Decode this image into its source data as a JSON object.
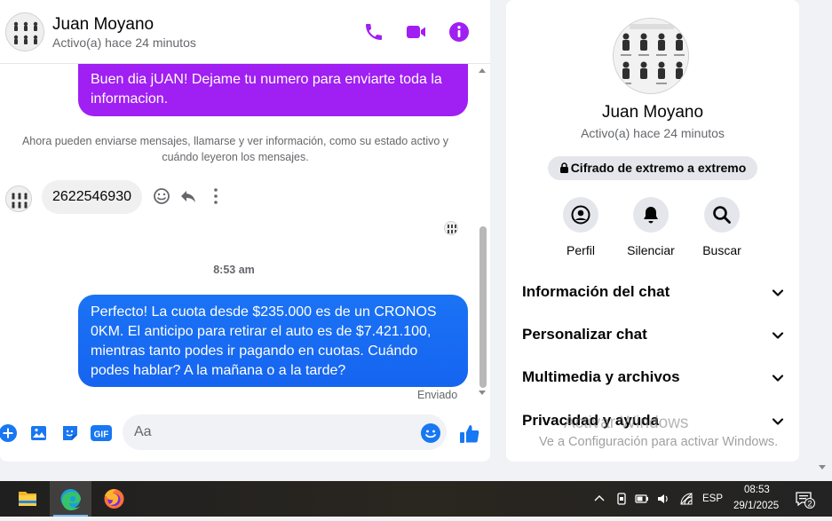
{
  "chat": {
    "contact_name": "Juan Moyano",
    "contact_status": "Activo(a) hace 24 minutos",
    "header_icons": [
      "phone-icon",
      "video-icon",
      "info-icon"
    ],
    "messages": {
      "sent_1": "Buen dia jUAN! Dejame tu numero para enviarte toda la informacion.",
      "system_notice": "Ahora pueden enviarse mensajes, llamarse y ver información, como su estado activo y cuándo leyeron los mensajes.",
      "received_1": "2622546930",
      "timestamp": "8:53 am",
      "sent_2": "Perfecto! La cuota desde $235.000 es de un CRONOS 0KM. El anticipo para retirar el auto es de $7.421.100, mientras tanto podes ir pagando en cuotas. Cuándo podes hablar? A la mañana o a la tarde?",
      "sent_status": "Enviado"
    },
    "composer": {
      "placeholder": "Aa",
      "gif_label": "GIF"
    },
    "colors": {
      "purple_bubble": "#a01ff2",
      "blue_bubble": "#1a73f5",
      "accent": "#a01ff2"
    }
  },
  "info_panel": {
    "name": "Juan Moyano",
    "status": "Activo(a) hace 24 minutos",
    "e2e_label": "Cifrado de extremo a extremo",
    "actions": [
      {
        "label": "Perfil",
        "icon": "profile-icon"
      },
      {
        "label": "Silenciar",
        "icon": "bell-icon"
      },
      {
        "label": "Buscar",
        "icon": "search-icon"
      }
    ],
    "sections": [
      {
        "label": "Información del chat"
      },
      {
        "label": "Personalizar chat"
      },
      {
        "label": "Multimedia y archivos"
      },
      {
        "label": "Privacidad y ayuda"
      }
    ]
  },
  "watermark": {
    "line1": "Activar Windows",
    "line2": "Ve a Configuración para activar Windows."
  },
  "taskbar": {
    "apps": [
      "file-explorer-icon",
      "edge-icon",
      "firefox-icon"
    ],
    "language": "ESP",
    "time": "08:53",
    "date": "29/1/2025",
    "notification_count": "2"
  }
}
